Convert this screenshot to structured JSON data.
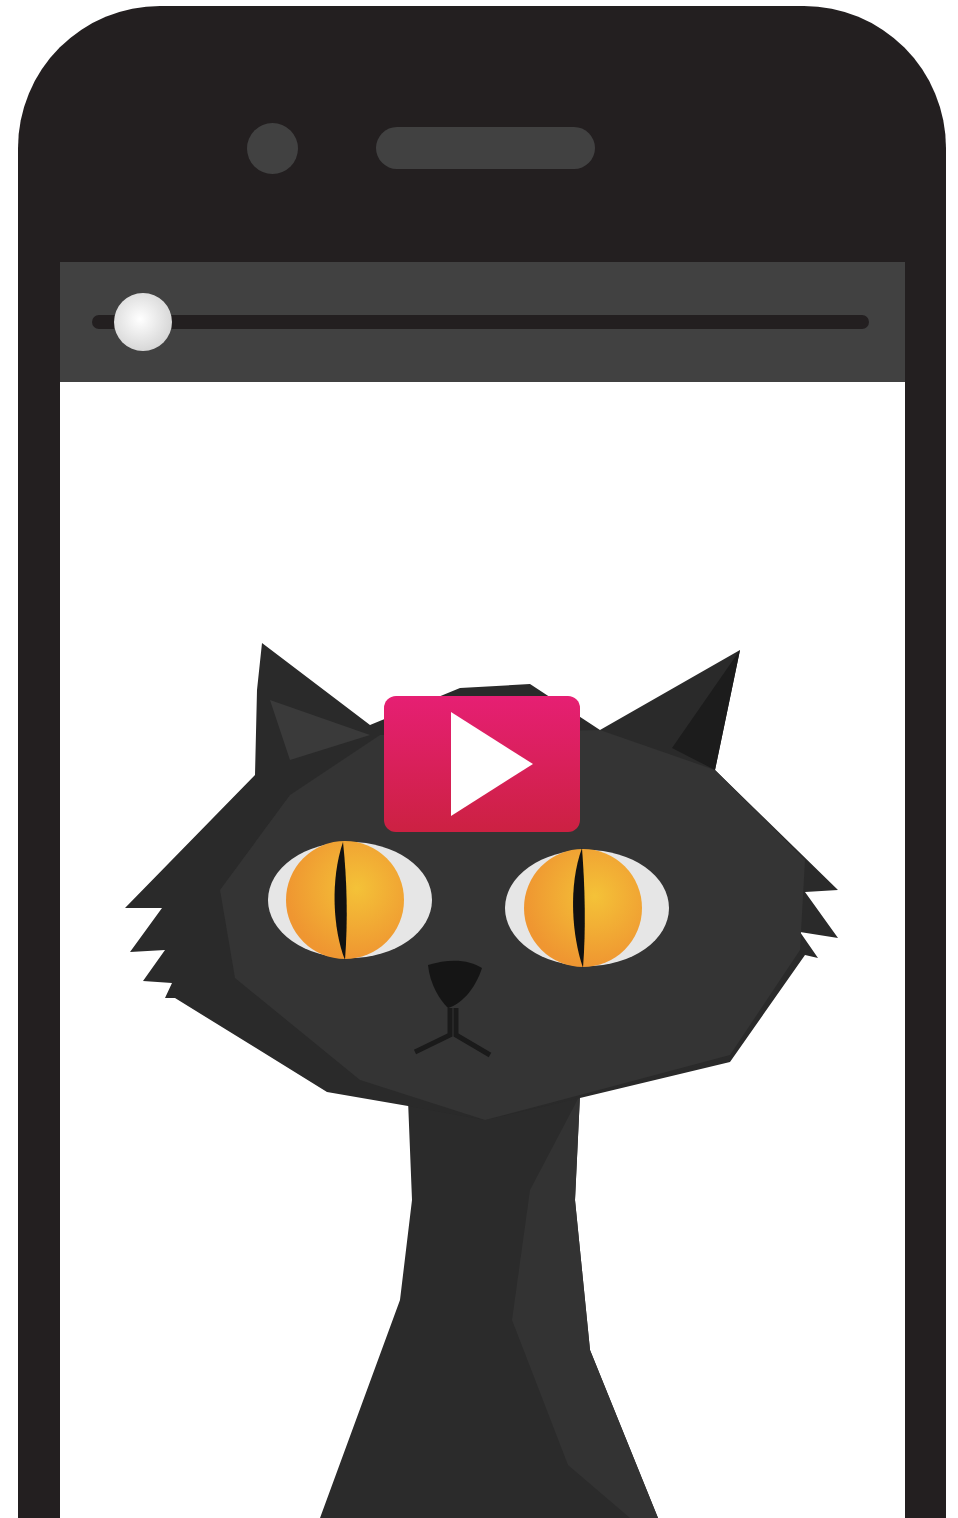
{
  "player": {
    "progress": {
      "level": 0.065
    }
  }
}
